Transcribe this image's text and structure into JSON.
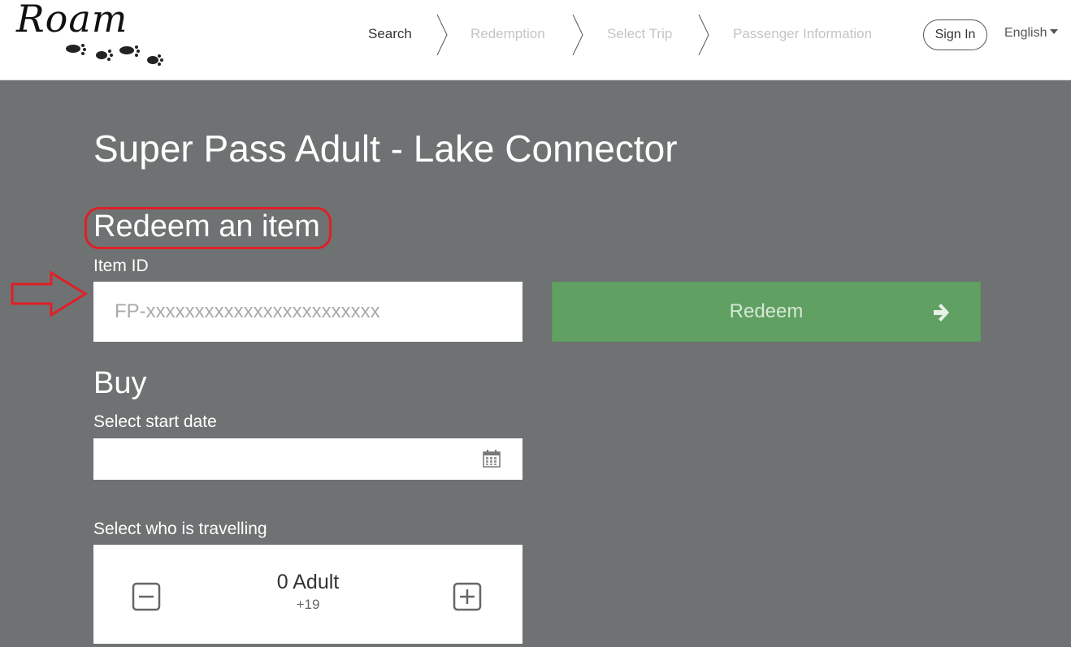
{
  "header": {
    "logo_text": "Roam",
    "steps": [
      {
        "label": "Search",
        "active": true
      },
      {
        "label": "Redemption",
        "active": false
      },
      {
        "label": "Select Trip",
        "active": false
      },
      {
        "label": "Passenger Information",
        "active": false
      }
    ],
    "sign_in_label": "Sign In",
    "language": "English"
  },
  "page": {
    "title": "Super Pass Adult - Lake Connector"
  },
  "redeem": {
    "heading": "Redeem an item",
    "item_id_label": "Item ID",
    "item_id_placeholder": "FP-xxxxxxxxxxxxxxxxxxxxxxxx",
    "item_id_value": "",
    "button_label": "Redeem",
    "button_color": "#61a063"
  },
  "buy": {
    "heading": "Buy",
    "start_date_label": "Select start date",
    "start_date_value": "",
    "travellers_label": "Select who is travelling",
    "traveller_count": "0 Adult",
    "traveller_age": "+19"
  },
  "annotations": {
    "highlight_color": "#e01f26"
  },
  "icons": [
    "calendar-icon",
    "arrow-right-icon",
    "minus-icon",
    "plus-icon",
    "caret-down-icon",
    "chevron-right-icon"
  ]
}
